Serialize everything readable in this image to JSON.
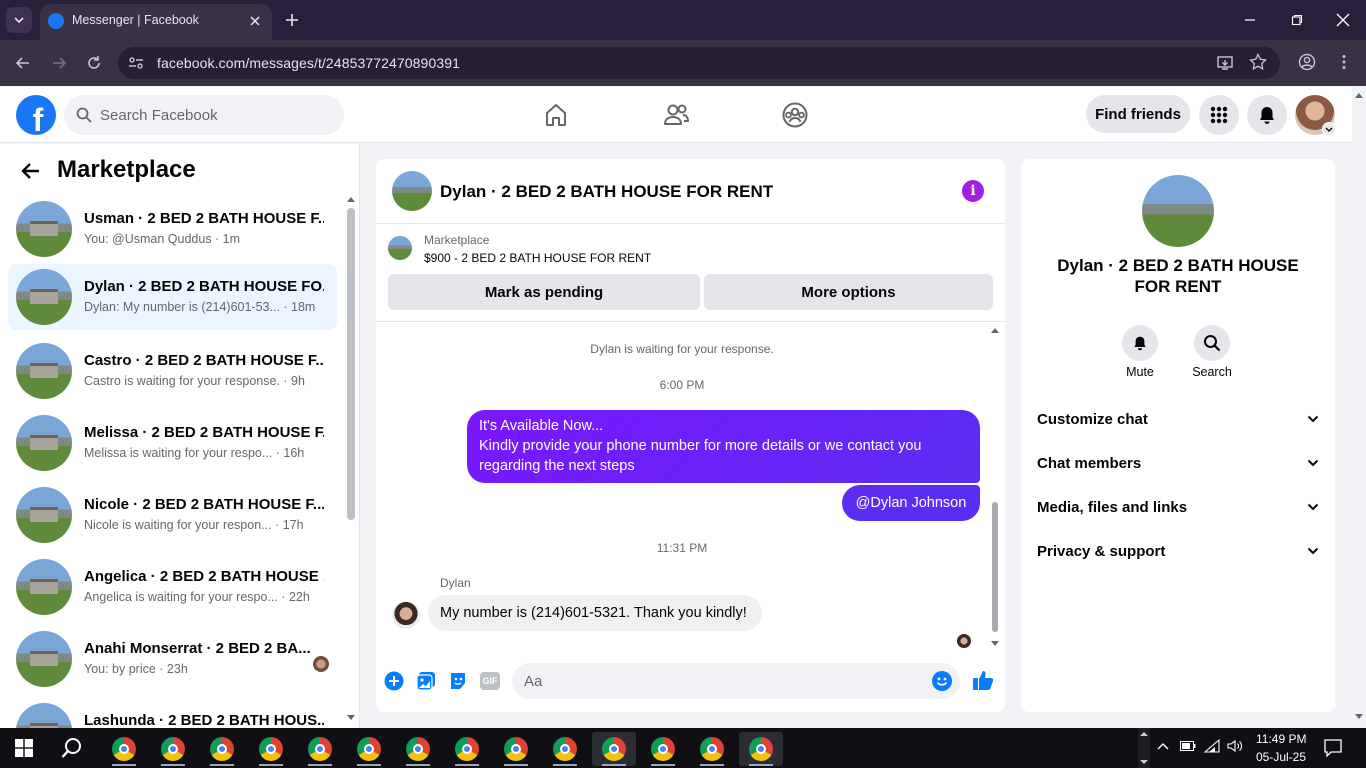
{
  "browser": {
    "tab_title": "Messenger | Facebook",
    "url": "facebook.com/messages/t/24853772470890391"
  },
  "header": {
    "search_placeholder": "Search Facebook",
    "find_friends": "Find friends",
    "logo_letter": "f"
  },
  "sidebar": {
    "title": "Marketplace",
    "conversations": [
      {
        "name": "Usman · 2 BED 2 BATH HOUSE F...",
        "preview": "You: @Usman Quddus · 1m"
      },
      {
        "name": "Dylan · 2 BED 2 BATH HOUSE FO...",
        "preview": "Dylan: My number is (214)601-53... · 18m"
      },
      {
        "name": "Castro · 2 BED 2 BATH HOUSE F...",
        "preview": "Castro is waiting for your response. · 9h"
      },
      {
        "name": "Melissa · 2 BED 2 BATH HOUSE F...",
        "preview": "Melissa is waiting for your respo... · 16h"
      },
      {
        "name": "Nicole · 2 BED 2 BATH HOUSE F...",
        "preview": "Nicole is waiting for your respon... · 17h"
      },
      {
        "name": "Angelica · 2 BED 2 BATH HOUSE ...",
        "preview": "Angelica is waiting for your respo... · 22h"
      },
      {
        "name": "Anahi Monserrat · 2 BED 2 BA...",
        "preview": "You: by price · 23h"
      },
      {
        "name": "Lashunda · 2 BED 2 BATH HOUS...",
        "preview": ""
      }
    ]
  },
  "chat": {
    "title": "Dylan · 2 BED 2 BATH HOUSE FOR RENT",
    "listing_label": "Marketplace",
    "listing_price": "$900 - 2 BED 2 BATH HOUSE FOR RENT",
    "mark_pending": "Mark as pending",
    "more_options": "More options",
    "waiting_note": "Dylan is waiting for your response.",
    "time1": "6:00 PM",
    "out_msg1_line1": "It's Available Now...",
    "out_msg1_line2": "Kindly provide your phone number for more details or we contact you regarding the next steps",
    "out_msg2": "@Dylan Johnson",
    "time2": "11:31 PM",
    "sender": "Dylan",
    "in_msg": "My number is (214)601-5321. Thank you kindly!",
    "composer_placeholder": "Aa",
    "gif_label": "GIF"
  },
  "details": {
    "name": "Dylan · 2 BED 2 BATH HOUSE FOR RENT",
    "mute": "Mute",
    "search": "Search",
    "sections": [
      "Customize chat",
      "Chat members",
      "Media, files and links",
      "Privacy & support"
    ]
  },
  "taskbar": {
    "time": "11:49 PM",
    "date": "05-Jul-25"
  },
  "colors": {
    "fb_blue": "#1877f2",
    "messenger_purple": "#7b16ff",
    "chrome_frame": "#3b3147"
  }
}
